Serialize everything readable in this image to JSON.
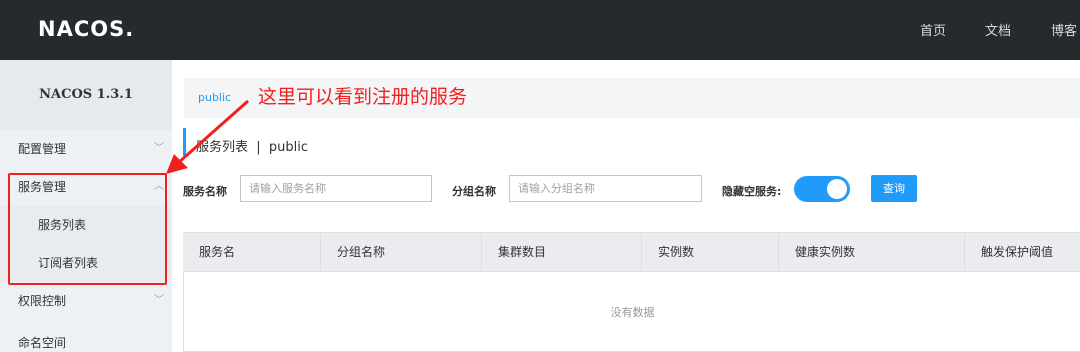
{
  "header": {
    "logo": "NACOS.",
    "nav": [
      "首页",
      "文档",
      "博客"
    ]
  },
  "sidebar": {
    "title": "NACOS 1.3.1",
    "items": [
      {
        "label": "配置管理"
      },
      {
        "label": "服务管理"
      },
      {
        "label": "服务列表"
      },
      {
        "label": "订阅者列表"
      },
      {
        "label": "权限控制"
      },
      {
        "label": "命名空间"
      }
    ]
  },
  "breadcrumb": {
    "namespace": "public"
  },
  "page": {
    "title": "服务列表  |  public"
  },
  "filters": {
    "service_label": "服务名称",
    "service_placeholder": "请输入服务名称",
    "group_label": "分组名称",
    "group_placeholder": "请输入分组名称",
    "hide_empty_label": "隐藏空服务:",
    "query_label": "查询"
  },
  "table": {
    "columns": [
      "服务名",
      "分组名称",
      "集群数目",
      "实例数",
      "健康实例数",
      "触发保护阈值"
    ],
    "empty_text": "没有数据"
  },
  "annotation": {
    "text": "这里可以看到注册的服务",
    "color": "#f0201e"
  },
  "colors": {
    "accent": "#209bfa",
    "header_bg": "#252a2f"
  }
}
